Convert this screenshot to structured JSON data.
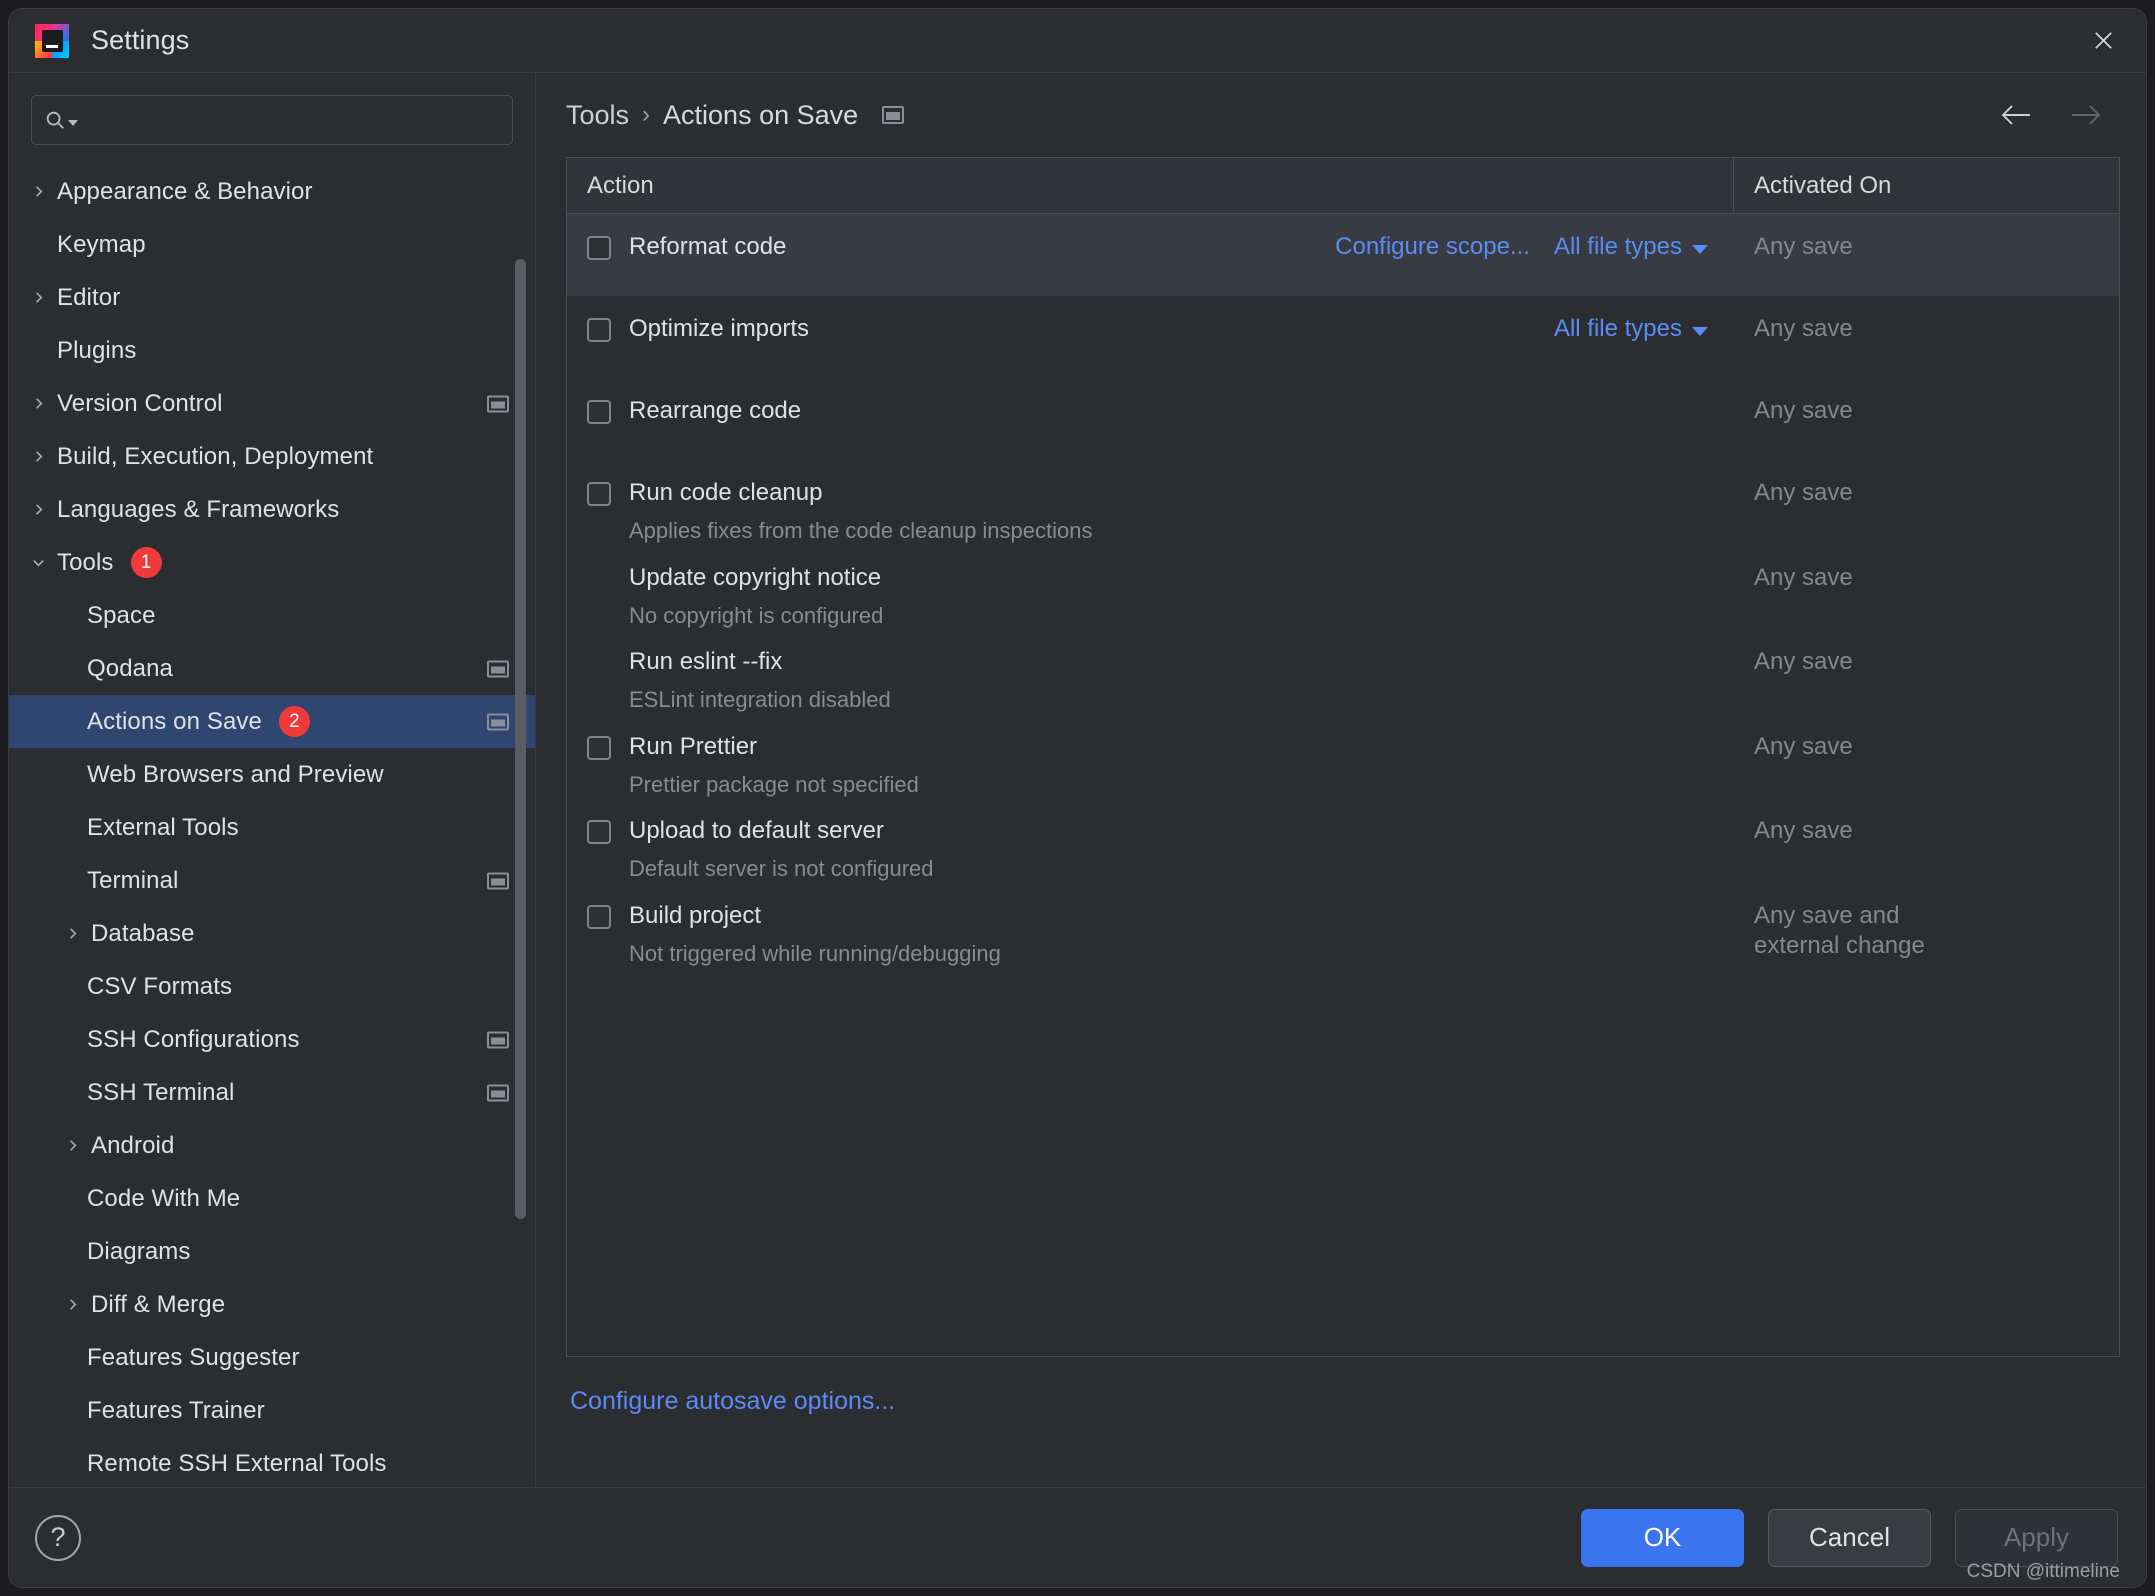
{
  "window": {
    "title": "Settings",
    "logo_text": "IJ",
    "close_icon": "close-icon"
  },
  "search": {
    "value": "",
    "placeholder": ""
  },
  "sidebar": {
    "items": [
      {
        "label": "Appearance & Behavior",
        "level": 0,
        "twisty": "right",
        "selected": false,
        "project_icon": false
      },
      {
        "label": "Keymap",
        "level": 0,
        "twisty": "none",
        "selected": false,
        "project_icon": false
      },
      {
        "label": "Editor",
        "level": 0,
        "twisty": "right",
        "selected": false,
        "project_icon": false
      },
      {
        "label": "Plugins",
        "level": 0,
        "twisty": "none",
        "selected": false,
        "project_icon": false
      },
      {
        "label": "Version Control",
        "level": 0,
        "twisty": "right",
        "selected": false,
        "project_icon": true
      },
      {
        "label": "Build, Execution, Deployment",
        "level": 0,
        "twisty": "right",
        "selected": false,
        "project_icon": false
      },
      {
        "label": "Languages & Frameworks",
        "level": 0,
        "twisty": "right",
        "selected": false,
        "project_icon": false
      },
      {
        "label": "Tools",
        "level": 0,
        "twisty": "down",
        "selected": false,
        "badge": "1",
        "project_icon": false
      },
      {
        "label": "Space",
        "level": 1,
        "twisty": "none",
        "selected": false,
        "project_icon": false
      },
      {
        "label": "Qodana",
        "level": 1,
        "twisty": "none",
        "selected": false,
        "project_icon": true
      },
      {
        "label": "Actions on Save",
        "level": 1,
        "twisty": "none",
        "selected": true,
        "badge": "2",
        "project_icon": true
      },
      {
        "label": "Web Browsers and Preview",
        "level": 1,
        "twisty": "none",
        "selected": false,
        "project_icon": false
      },
      {
        "label": "External Tools",
        "level": 1,
        "twisty": "none",
        "selected": false,
        "project_icon": false
      },
      {
        "label": "Terminal",
        "level": 1,
        "twisty": "none",
        "selected": false,
        "project_icon": true
      },
      {
        "label": "Database",
        "level": 1,
        "twisty": "right",
        "selected": false,
        "project_icon": false
      },
      {
        "label": "CSV Formats",
        "level": 1,
        "twisty": "none",
        "selected": false,
        "project_icon": false
      },
      {
        "label": "SSH Configurations",
        "level": 1,
        "twisty": "none",
        "selected": false,
        "project_icon": true
      },
      {
        "label": "SSH Terminal",
        "level": 1,
        "twisty": "none",
        "selected": false,
        "project_icon": true
      },
      {
        "label": "Android",
        "level": 1,
        "twisty": "right",
        "selected": false,
        "project_icon": false
      },
      {
        "label": "Code With Me",
        "level": 1,
        "twisty": "none",
        "selected": false,
        "project_icon": false
      },
      {
        "label": "Diagrams",
        "level": 1,
        "twisty": "none",
        "selected": false,
        "project_icon": false
      },
      {
        "label": "Diff & Merge",
        "level": 1,
        "twisty": "right",
        "selected": false,
        "project_icon": false
      },
      {
        "label": "Features Suggester",
        "level": 1,
        "twisty": "none",
        "selected": false,
        "project_icon": false
      },
      {
        "label": "Features Trainer",
        "level": 1,
        "twisty": "none",
        "selected": false,
        "project_icon": false
      },
      {
        "label": "Remote SSH External Tools",
        "level": 1,
        "twisty": "none",
        "selected": false,
        "project_icon": false
      }
    ]
  },
  "breadcrumb": {
    "parent": "Tools",
    "separator": "›",
    "current": "Actions on Save",
    "project_icon": "project-settings-icon"
  },
  "nav": {
    "back_icon": "arrow-left-icon",
    "forward_icon": "arrow-right-icon"
  },
  "table": {
    "headers": {
      "action": "Action",
      "activated_on": "Activated On"
    },
    "rows": [
      {
        "name": "Reformat code",
        "desc": "",
        "checkbox": true,
        "checked": false,
        "highlight": true,
        "scope_link": "Configure scope...",
        "file_types": "All file types",
        "activated_on": "Any save"
      },
      {
        "name": "Optimize imports",
        "desc": "",
        "checkbox": true,
        "checked": false,
        "highlight": false,
        "scope_link": "",
        "file_types": "All file types",
        "activated_on": "Any save"
      },
      {
        "name": "Rearrange code",
        "desc": "",
        "checkbox": true,
        "checked": false,
        "highlight": false,
        "scope_link": "",
        "file_types": "",
        "activated_on": "Any save"
      },
      {
        "name": "Run code cleanup",
        "desc": "Applies fixes from the code cleanup inspections",
        "checkbox": true,
        "checked": false,
        "highlight": false,
        "scope_link": "",
        "file_types": "",
        "activated_on": "Any save"
      },
      {
        "name": "Update copyright notice",
        "desc": "No copyright is configured",
        "checkbox": false,
        "checked": false,
        "highlight": false,
        "scope_link": "",
        "file_types": "",
        "activated_on": "Any save"
      },
      {
        "name": "Run eslint --fix",
        "desc": "ESLint integration disabled",
        "checkbox": false,
        "checked": false,
        "highlight": false,
        "scope_link": "",
        "file_types": "",
        "activated_on": "Any save"
      },
      {
        "name": "Run Prettier",
        "desc": "Prettier package not specified",
        "checkbox": true,
        "checked": false,
        "highlight": false,
        "scope_link": "",
        "file_types": "",
        "activated_on": "Any save"
      },
      {
        "name": "Upload to default server",
        "desc": "Default server is not configured",
        "checkbox": true,
        "checked": false,
        "highlight": false,
        "scope_link": "",
        "file_types": "",
        "activated_on": "Any save"
      },
      {
        "name": "Build project",
        "desc": "Not triggered while running/debugging",
        "checkbox": true,
        "checked": false,
        "highlight": false,
        "scope_link": "",
        "file_types": "",
        "activated_on": "Any save and\nexternal change"
      }
    ]
  },
  "autosave": {
    "link": "Configure autosave options..."
  },
  "footer": {
    "help_glyph": "?",
    "ok": "OK",
    "cancel": "Cancel",
    "apply": "Apply",
    "watermark": "CSDN @ittimeline"
  },
  "colors": {
    "accent_blue": "#3b74ef",
    "link_blue": "#5b8cf5",
    "badge_red": "#f03a3a",
    "selection_blue": "#2f4670",
    "panel_bg": "#2b2d30"
  }
}
